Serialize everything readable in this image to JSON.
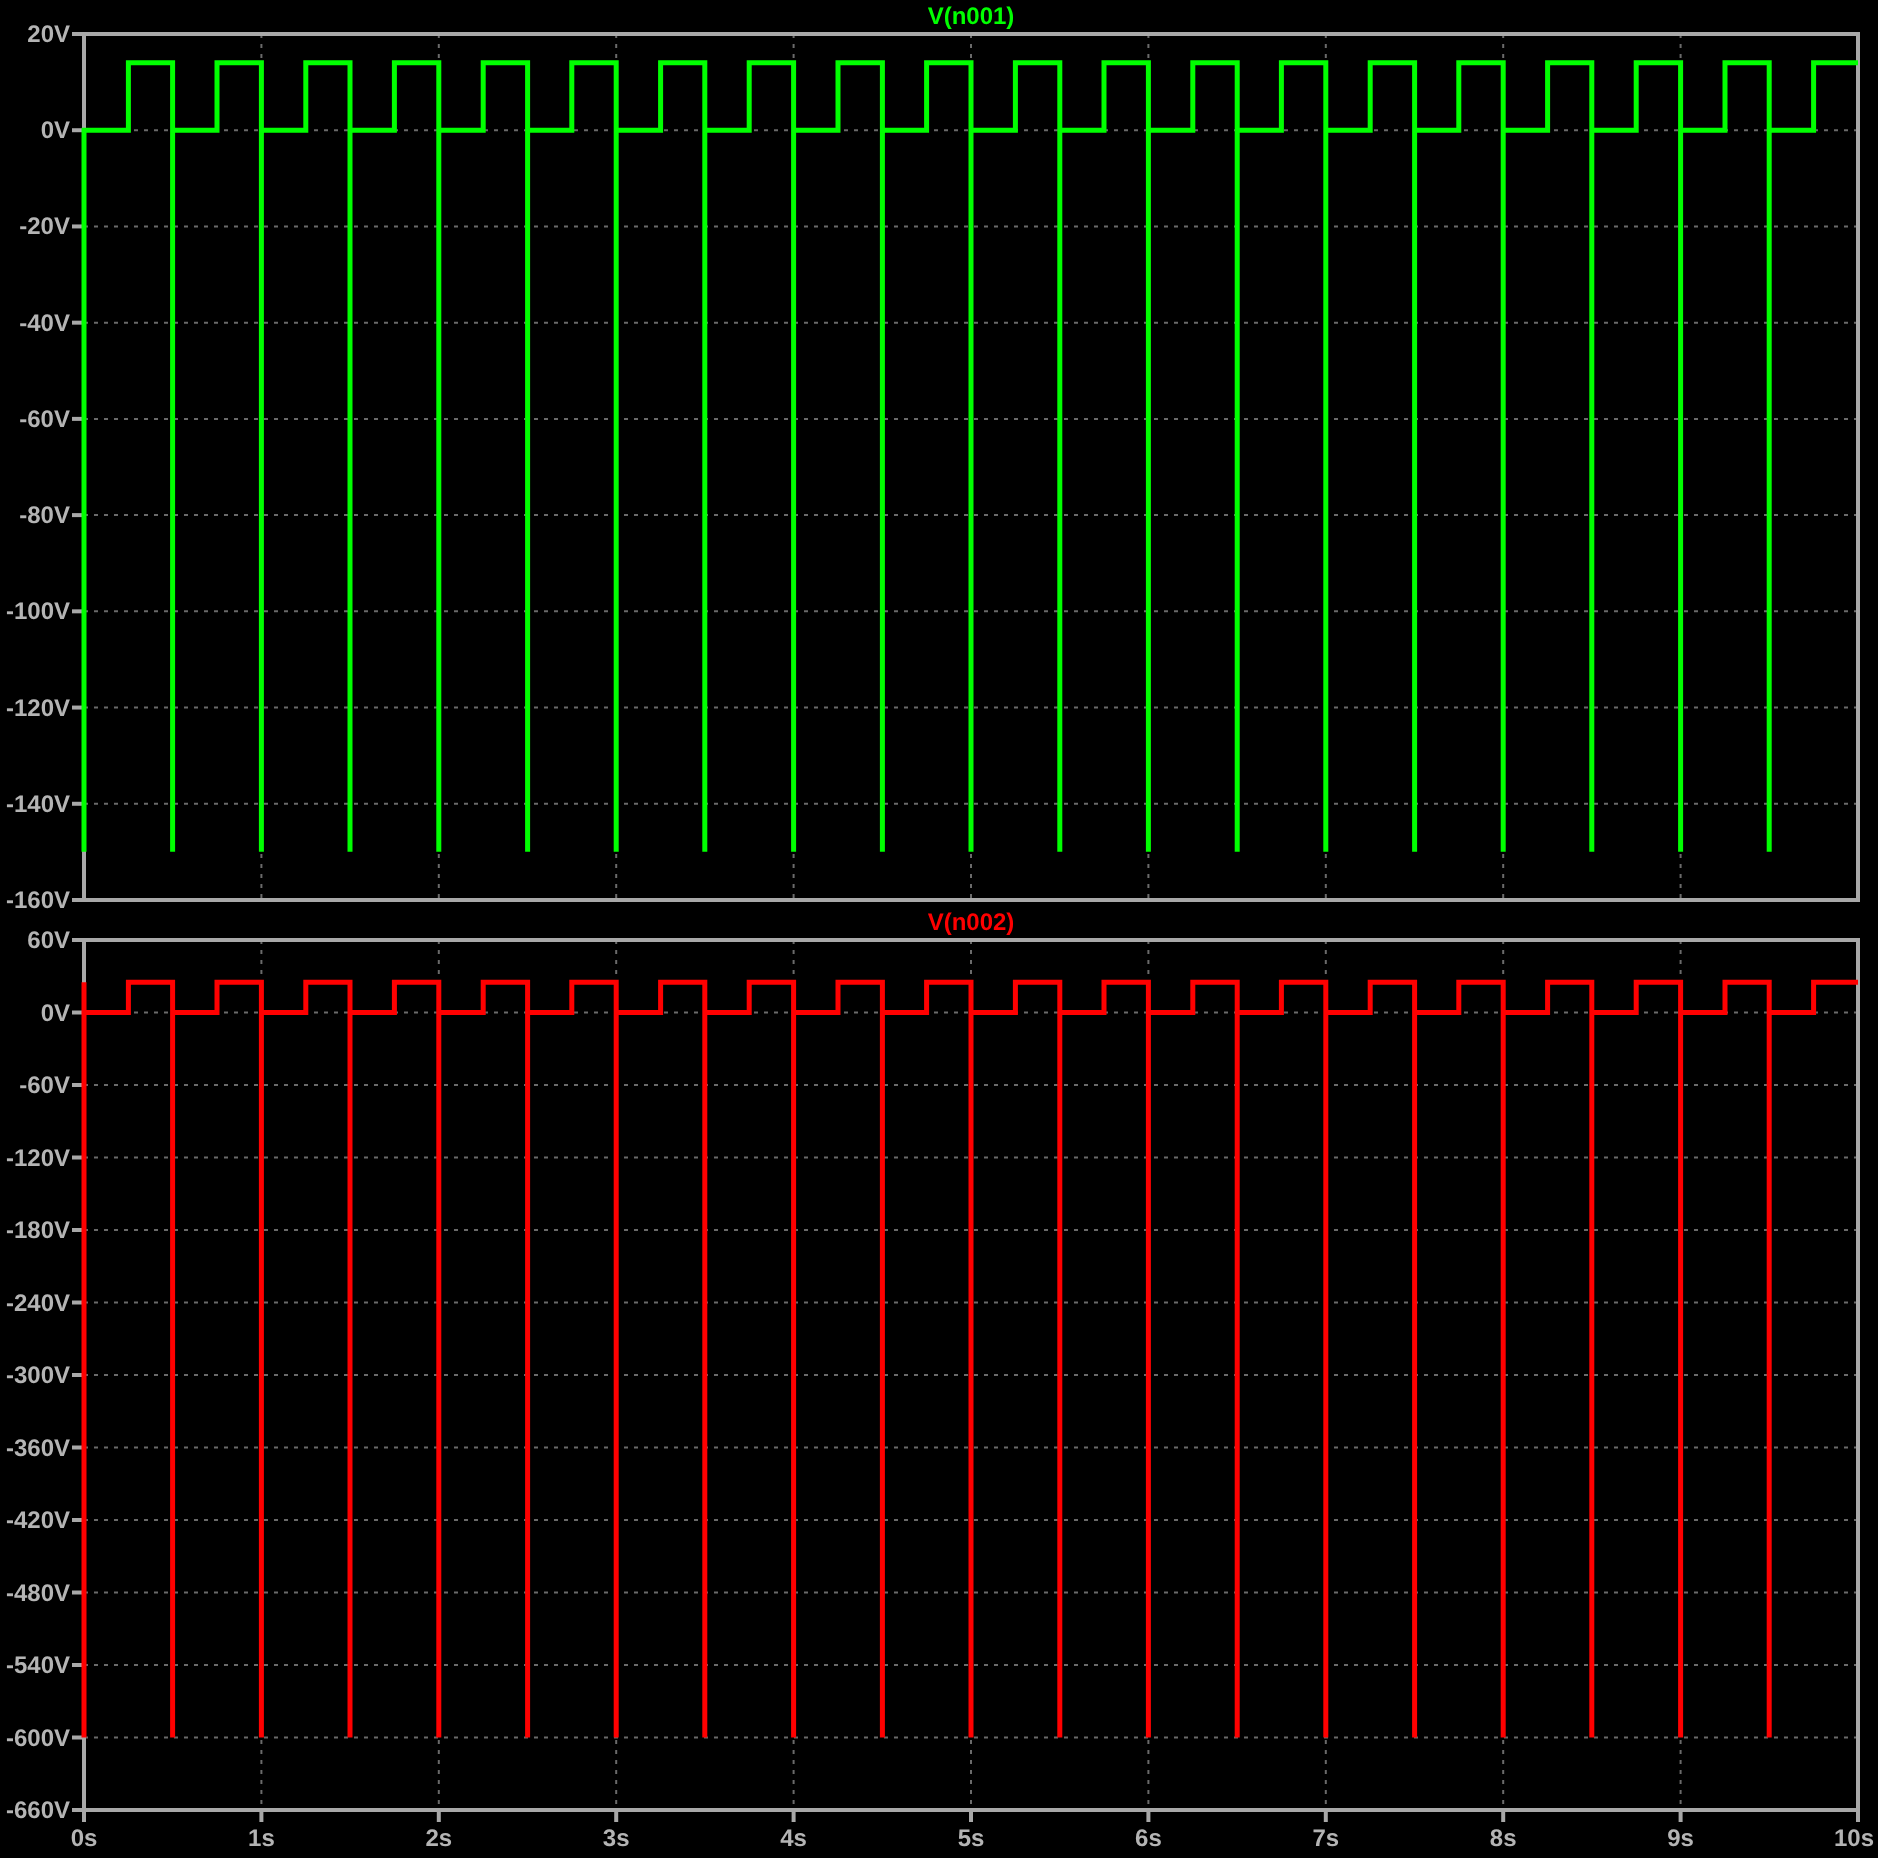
{
  "plots": [
    {
      "chart_data": {
        "type": "line",
        "grid": true,
        "x": [
          0,
          0,
          0.25,
          0.25,
          0.5,
          0.5,
          0.5,
          0.75,
          0.75,
          1,
          1,
          1,
          1.25,
          1.25,
          1.5,
          1.5,
          1.5,
          1.75,
          1.75,
          2,
          2,
          2,
          2.25,
          2.25,
          2.5,
          2.5,
          2.5,
          2.75,
          2.75,
          3,
          3,
          3,
          3.25,
          3.25,
          3.5,
          3.5,
          3.5,
          3.75,
          3.75,
          4,
          4,
          4,
          4.25,
          4.25,
          4.5,
          4.5,
          4.5,
          4.75,
          4.75,
          5,
          5,
          5,
          5.25,
          5.25,
          5.5,
          5.5,
          5.5,
          5.75,
          5.75,
          6,
          6,
          6,
          6.25,
          6.25,
          6.5,
          6.5,
          6.5,
          6.75,
          6.75,
          7,
          7,
          7,
          7.25,
          7.25,
          7.5,
          7.5,
          7.5,
          7.75,
          7.75,
          8,
          8,
          8,
          8.25,
          8.25,
          8.5,
          8.5,
          8.5,
          8.75,
          8.75,
          9,
          9,
          9,
          9.25,
          9.25,
          9.5,
          9.5,
          9.5,
          9.75,
          9.75,
          10
        ],
        "series": [
          {
            "name": "V(n001)",
            "color": "#00ff00",
            "values": [
              -150,
              0,
              0,
              14,
              14,
              -150,
              0,
              0,
              14,
              14,
              -150,
              0,
              0,
              14,
              14,
              -150,
              0,
              0,
              14,
              14,
              -150,
              0,
              0,
              14,
              14,
              -150,
              0,
              0,
              14,
              14,
              -150,
              0,
              0,
              14,
              14,
              -150,
              0,
              0,
              14,
              14,
              -150,
              0,
              0,
              14,
              14,
              -150,
              0,
              0,
              14,
              14,
              -150,
              0,
              0,
              14,
              14,
              -150,
              0,
              0,
              14,
              14,
              -150,
              0,
              0,
              14,
              14,
              -150,
              0,
              0,
              14,
              14,
              -150,
              0,
              0,
              14,
              14,
              -150,
              0,
              0,
              14,
              14,
              -150,
              0,
              0,
              14,
              14,
              -150,
              0,
              0,
              14,
              14,
              -150,
              0,
              0,
              14,
              14,
              -150,
              0,
              0,
              14,
              14
            ]
          }
        ],
        "xlim": [
          0,
          10
        ],
        "ylim": [
          -160,
          20
        ],
        "yticks": [
          {
            "value": 20,
            "label": "20V"
          },
          {
            "value": 0,
            "label": "0V"
          },
          {
            "value": -20,
            "label": "-20V"
          },
          {
            "value": -40,
            "label": "-40V"
          },
          {
            "value": -60,
            "label": "-60V"
          },
          {
            "value": -80,
            "label": "-80V"
          },
          {
            "value": -100,
            "label": "-100V"
          },
          {
            "value": -120,
            "label": "-120V"
          },
          {
            "value": -140,
            "label": "-140V"
          },
          {
            "value": -160,
            "label": "-160V"
          }
        ]
      }
    },
    {
      "chart_data": {
        "type": "line",
        "grid": true,
        "x": [
          0,
          0,
          0,
          0.25,
          0.25,
          0.5,
          0.5,
          0.5,
          0.75,
          0.75,
          1,
          1,
          1,
          1.25,
          1.25,
          1.5,
          1.5,
          1.5,
          1.75,
          1.75,
          2,
          2,
          2,
          2.25,
          2.25,
          2.5,
          2.5,
          2.5,
          2.75,
          2.75,
          3,
          3,
          3,
          3.25,
          3.25,
          3.5,
          3.5,
          3.5,
          3.75,
          3.75,
          4,
          4,
          4,
          4.25,
          4.25,
          4.5,
          4.5,
          4.5,
          4.75,
          4.75,
          5,
          5,
          5,
          5.25,
          5.25,
          5.5,
          5.5,
          5.5,
          5.75,
          5.75,
          6,
          6,
          6,
          6.25,
          6.25,
          6.5,
          6.5,
          6.5,
          6.75,
          6.75,
          7,
          7,
          7,
          7.25,
          7.25,
          7.5,
          7.5,
          7.5,
          7.75,
          7.75,
          8,
          8,
          8,
          8.25,
          8.25,
          8.5,
          8.5,
          8.5,
          8.75,
          8.75,
          9,
          9,
          9,
          9.25,
          9.25,
          9.5,
          9.5,
          9.5,
          9.75,
          9.75,
          10
        ],
        "series": [
          {
            "name": "V(n002)",
            "color": "#ff0000",
            "values": [
              -600,
              25,
              0,
              0,
              25,
              25,
              -600,
              0,
              0,
              25,
              25,
              -600,
              0,
              0,
              25,
              25,
              -600,
              0,
              0,
              25,
              25,
              -600,
              0,
              0,
              25,
              25,
              -600,
              0,
              0,
              25,
              25,
              -600,
              0,
              0,
              25,
              25,
              -600,
              0,
              0,
              25,
              25,
              -600,
              0,
              0,
              25,
              25,
              -600,
              0,
              0,
              25,
              25,
              -600,
              0,
              0,
              25,
              25,
              -600,
              0,
              0,
              25,
              25,
              -600,
              0,
              0,
              25,
              25,
              -600,
              0,
              0,
              25,
              25,
              -600,
              0,
              0,
              25,
              25,
              -600,
              0,
              0,
              25,
              25,
              -600,
              0,
              0,
              25,
              25,
              -600,
              0,
              0,
              25,
              25,
              -600,
              0,
              0,
              25,
              25,
              -600,
              0,
              0,
              25,
              25
            ]
          }
        ],
        "xlim": [
          0,
          10
        ],
        "ylim": [
          -660,
          60
        ],
        "xticks": [
          {
            "value": 0,
            "label": "0s"
          },
          {
            "value": 1,
            "label": "1s"
          },
          {
            "value": 2,
            "label": "2s"
          },
          {
            "value": 3,
            "label": "3s"
          },
          {
            "value": 4,
            "label": "4s"
          },
          {
            "value": 5,
            "label": "5s"
          },
          {
            "value": 6,
            "label": "6s"
          },
          {
            "value": 7,
            "label": "7s"
          },
          {
            "value": 8,
            "label": "8s"
          },
          {
            "value": 9,
            "label": "9s"
          },
          {
            "value": 10,
            "label": "10s"
          }
        ],
        "yticks": [
          {
            "value": 60,
            "label": "60V"
          },
          {
            "value": 0,
            "label": "0V"
          },
          {
            "value": -60,
            "label": "-60V"
          },
          {
            "value": -120,
            "label": "-120V"
          },
          {
            "value": -180,
            "label": "-180V"
          },
          {
            "value": -240,
            "label": "-240V"
          },
          {
            "value": -300,
            "label": "-300V"
          },
          {
            "value": -360,
            "label": "-360V"
          },
          {
            "value": -420,
            "label": "-420V"
          },
          {
            "value": -480,
            "label": "-480V"
          },
          {
            "value": -540,
            "label": "-540V"
          },
          {
            "value": -600,
            "label": "-600V"
          },
          {
            "value": -660,
            "label": "-660V"
          }
        ]
      }
    }
  ]
}
